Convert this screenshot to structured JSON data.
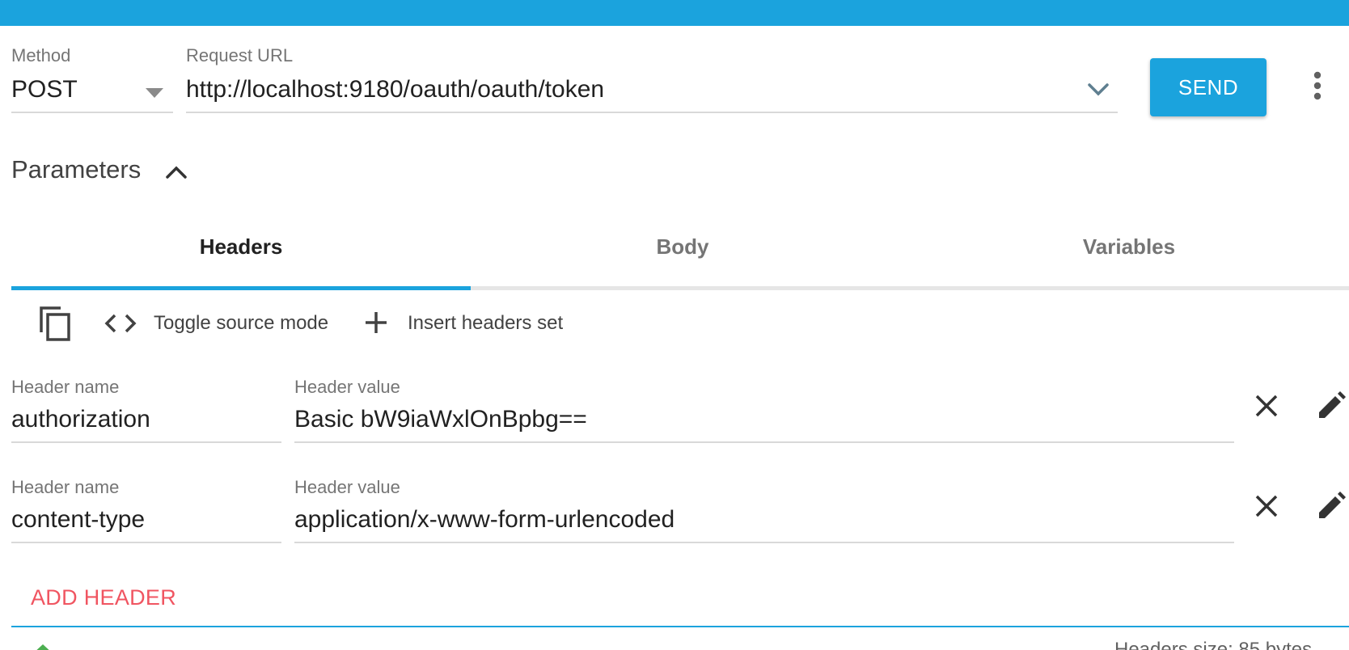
{
  "request": {
    "method_label": "Method",
    "method_value": "POST",
    "url_label": "Request URL",
    "url_value": "http://localhost:9180/oauth/oauth/token",
    "send_label": "SEND"
  },
  "parameters": {
    "title": "Parameters"
  },
  "tabs": [
    {
      "label": "Headers",
      "active": true
    },
    {
      "label": "Body",
      "active": false
    },
    {
      "label": "Variables",
      "active": false
    }
  ],
  "toolbar": {
    "copy_icon": "content-copy-icon",
    "toggle_icon": "code-icon",
    "toggle_label": "Toggle source mode",
    "insert_icon": "plus-icon",
    "insert_label": "Insert headers set"
  },
  "headers": [
    {
      "name_label": "Header name",
      "name_value": "authorization",
      "value_label": "Header value",
      "value_value": "Basic bW9iaWxlOnBpbg=="
    },
    {
      "name_label": "Header name",
      "name_value": "content-type",
      "value_label": "Header value",
      "value_value": "application/x-www-form-urlencoded"
    }
  ],
  "add_header_label": "ADD HEADER",
  "footer": {
    "headers_size_text": "Headers size: 85 bytes"
  },
  "colors": {
    "accent": "#1ba3dd",
    "add_header": "#f05561"
  }
}
